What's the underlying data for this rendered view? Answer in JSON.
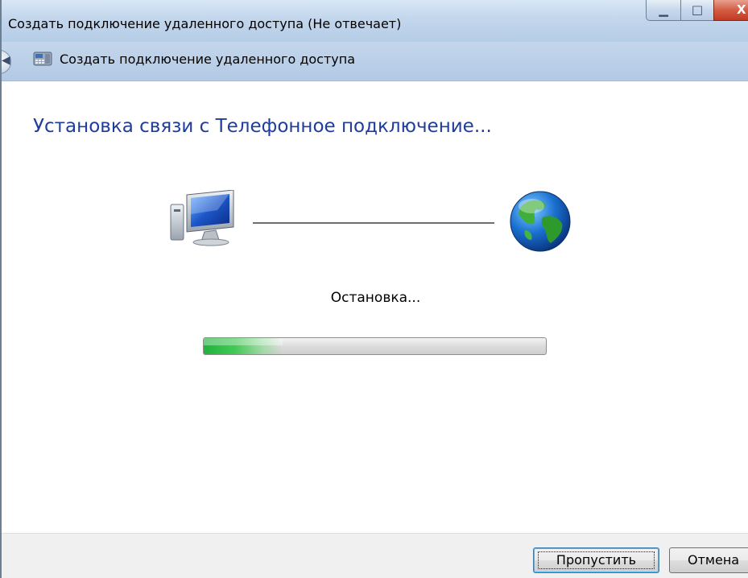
{
  "window": {
    "title": "Создать подключение удаленного доступа (Не отвечает)"
  },
  "header": {
    "text": "Создать подключение удаленного доступа",
    "back_icon": "back-arrow-icon",
    "app_icon": "dialup-phone-icon"
  },
  "content": {
    "heading": "Установка связи с Телефонное подключение...",
    "status": "Остановка...",
    "progress_fraction": 0.23,
    "icons": {
      "left": "computer-icon",
      "right": "globe-icon"
    }
  },
  "buttons": {
    "skip": "Пропустить",
    "cancel": "Отмена"
  },
  "colors": {
    "heading": "#1f3d9a",
    "progress_fill": "#20b23c",
    "titlebar": "#c2d6ec"
  }
}
